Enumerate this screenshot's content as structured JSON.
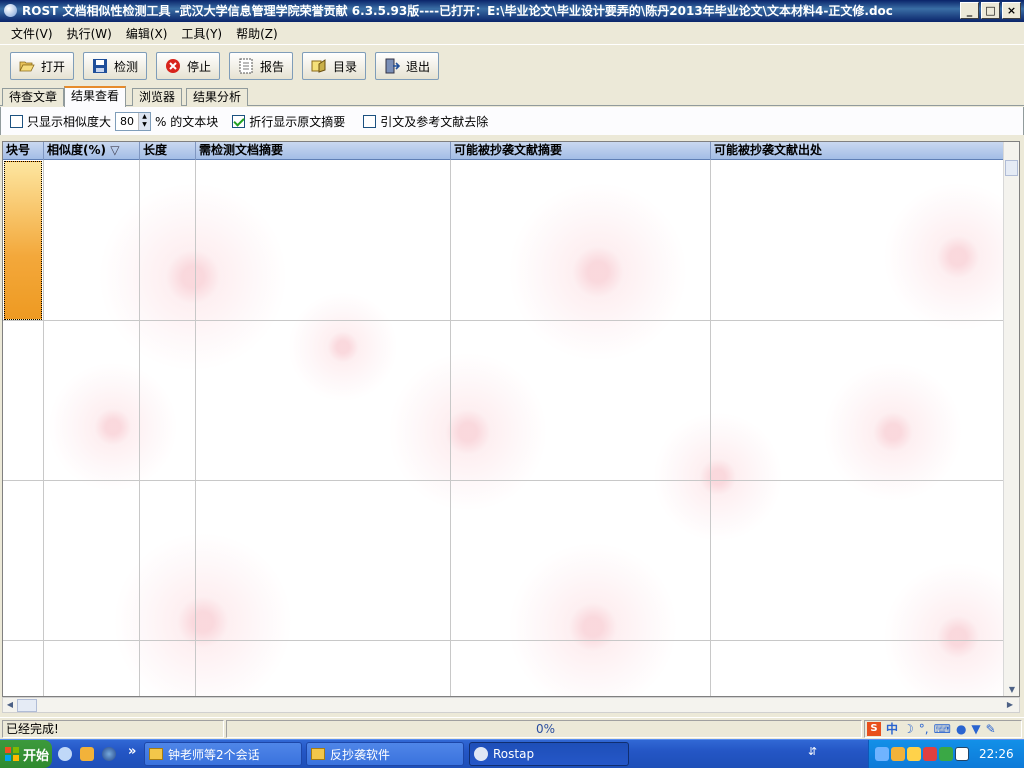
{
  "window": {
    "title": "ROST 文档相似性检测工具 -武汉大学信息管理学院荣誉贡献 6.3.5.93版----已打开：E:\\毕业论文\\毕业设计要弄的\\陈丹2013年毕业论文\\文本材料4-正文修.doc"
  },
  "menu": [
    "文件(V)",
    "执行(W)",
    "编辑(X)",
    "工具(Y)",
    "帮助(Z)"
  ],
  "toolbar": {
    "open": "打开",
    "detect": "检测",
    "stop": "停止",
    "report": "报告",
    "catalog": "目录",
    "exit": "退出"
  },
  "tabs": [
    "待查文章",
    "结果查看",
    "浏览器",
    "结果分析"
  ],
  "active_tab": 1,
  "options": {
    "only_show_label": "只显示相似度大",
    "threshold": "80",
    "threshold_suffix": "% 的文本块",
    "wrap_label": "折行显示原文摘要",
    "wrap_checked": true,
    "remove_refs_label": "引文及参考文献去除",
    "remove_refs_checked": false
  },
  "grid": {
    "columns": [
      "块号",
      "相似度(%)",
      "长度",
      "需检测文档摘要",
      "可能被抄袭文献摘要",
      "可能被抄袭文献出处"
    ],
    "sort_indicator": "▽"
  },
  "status": {
    "message": "已经完成!",
    "progress": "0%"
  },
  "taskbar": {
    "start": "开始",
    "chevron": "»",
    "items": [
      "钟老师等2个会话",
      "反抄袭软件",
      "Rostap"
    ],
    "clock": "22:26",
    "ime": "中"
  },
  "colors": {
    "title_bar": "#0a246a",
    "selected_cell": "#f3a83b",
    "grid_header": "#a3bde6",
    "taskbar": "#2456c5",
    "tab_highlight": "#e68b2c"
  }
}
